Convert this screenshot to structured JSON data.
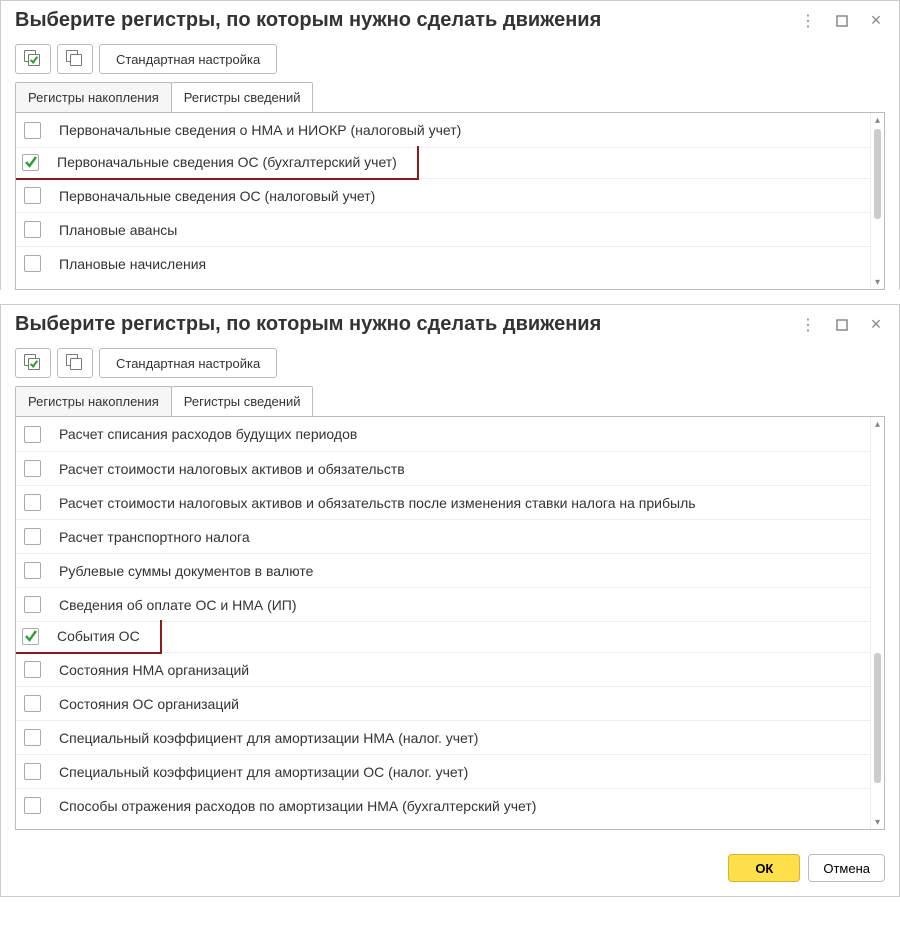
{
  "top": {
    "title": "Выберите регистры, по которым нужно сделать движения",
    "toolbar": {
      "std_settings": "Стандартная настройка"
    },
    "tabs": {
      "accum": "Регистры накопления",
      "info": "Регистры сведений"
    },
    "rows": [
      {
        "label": "Первоначальные сведения о НМА и НИОКР (налоговый учет)",
        "checked": false,
        "hl": false
      },
      {
        "label": "Первоначальные сведения ОС (бухгалтерский учет)",
        "checked": true,
        "hl": true
      },
      {
        "label": "Первоначальные сведения ОС (налоговый учет)",
        "checked": false,
        "hl": false
      },
      {
        "label": "Плановые авансы",
        "checked": false,
        "hl": false
      },
      {
        "label": "Плановые начисления",
        "checked": false,
        "hl": false
      }
    ]
  },
  "bottom": {
    "title": "Выберите регистры, по которым нужно сделать движения",
    "toolbar": {
      "std_settings": "Стандартная настройка"
    },
    "tabs": {
      "accum": "Регистры накопления",
      "info": "Регистры сведений"
    },
    "rows": [
      {
        "label": "Расчет списания расходов будущих периодов",
        "checked": false,
        "hl": false
      },
      {
        "label": "Расчет стоимости налоговых активов и обязательств",
        "checked": false,
        "hl": false
      },
      {
        "label": "Расчет стоимости налоговых активов и обязательств после изменения ставки налога на прибыль",
        "checked": false,
        "hl": false
      },
      {
        "label": "Расчет транспортного налога",
        "checked": false,
        "hl": false
      },
      {
        "label": "Рублевые суммы документов в валюте",
        "checked": false,
        "hl": false
      },
      {
        "label": "Сведения об оплате ОС и НМА (ИП)",
        "checked": false,
        "hl": false
      },
      {
        "label": "События ОС",
        "checked": true,
        "hl": true
      },
      {
        "label": "Состояния НМА организаций",
        "checked": false,
        "hl": false
      },
      {
        "label": "Состояния ОС организаций",
        "checked": false,
        "hl": false
      },
      {
        "label": "Специальный коэффициент для амортизации НМА (налог. учет)",
        "checked": false,
        "hl": false
      },
      {
        "label": "Специальный коэффициент для амортизации ОС (налог. учет)",
        "checked": false,
        "hl": false
      },
      {
        "label": "Способы отражения расходов по амортизации НМА (бухгалтерский учет)",
        "checked": false,
        "hl": false
      }
    ],
    "buttons": {
      "ok": "ОК",
      "cancel": "Отмена"
    }
  }
}
